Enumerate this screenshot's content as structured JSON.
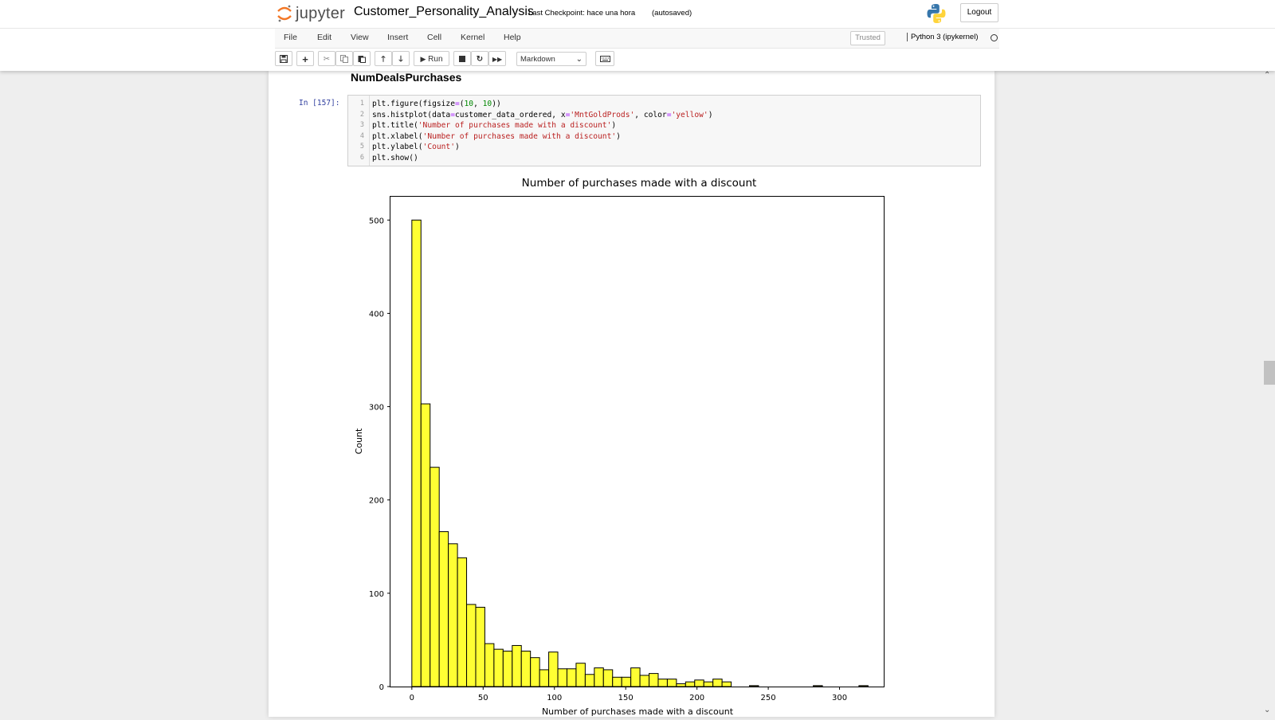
{
  "app": {
    "logo_text": "jupyter"
  },
  "notebook": {
    "name": "Customer_Personality_Analysis",
    "checkpoint": "Last Checkpoint: hace una hora",
    "autosave": "(autosaved)"
  },
  "header": {
    "logout_label": "Logout"
  },
  "menu": {
    "items": [
      "File",
      "Edit",
      "View",
      "Insert",
      "Cell",
      "Kernel",
      "Help"
    ],
    "trusted": "Trusted",
    "kernel": "Python 3 (ipykernel)"
  },
  "toolbar": {
    "run_label": "Run",
    "cell_type": "Markdown",
    "icons": [
      "save-icon",
      "plus-icon",
      "cut-icon",
      "copy-icon",
      "paste-icon",
      "arrow-up-icon",
      "arrow-down-icon",
      "run-icon",
      "stop-icon",
      "restart-icon",
      "fast-forward-icon",
      "keyboard-icon"
    ]
  },
  "cell": {
    "markdown_heading": "NumDealsPurchases",
    "prompt": "In [157]:",
    "line_numbers": [
      "1",
      "2",
      "3",
      "4",
      "5",
      "6"
    ],
    "code": [
      "plt.figure(figsize=(10, 10))",
      "sns.histplot(data=customer_data_ordered, x='MntGoldProds', color='yellow')",
      "plt.title('Number of purchases made with a discount')",
      "plt.xlabel('Number of purchases made with a discount')",
      "plt.ylabel('Count')",
      "plt.show()"
    ]
  },
  "chart_data": {
    "type": "bar",
    "title": "Number of purchases made with a discount",
    "xlabel": "Number of purchases made with a discount",
    "ylabel": "Count",
    "xlim": [
      -15,
      331
    ],
    "ylim": [
      0,
      525
    ],
    "xticks": [
      0,
      50,
      100,
      150,
      200,
      250,
      300
    ],
    "yticks": [
      0,
      100,
      200,
      300,
      400,
      500
    ],
    "bin_width": 6.4,
    "bin_start": 0,
    "values": [
      500,
      303,
      235,
      166,
      153,
      138,
      88,
      85,
      46,
      40,
      38,
      44,
      38,
      31,
      18,
      37,
      19,
      19,
      25,
      13,
      20,
      18,
      10,
      10,
      20,
      12,
      14,
      8,
      8,
      3,
      5,
      7,
      5,
      8,
      5,
      0,
      0,
      1,
      0,
      0,
      0,
      0,
      0,
      0,
      1,
      0,
      0,
      0,
      0,
      1
    ],
    "bar_color": "#ffff33",
    "edge_color": "#000000",
    "grid": false,
    "legend": "none"
  }
}
